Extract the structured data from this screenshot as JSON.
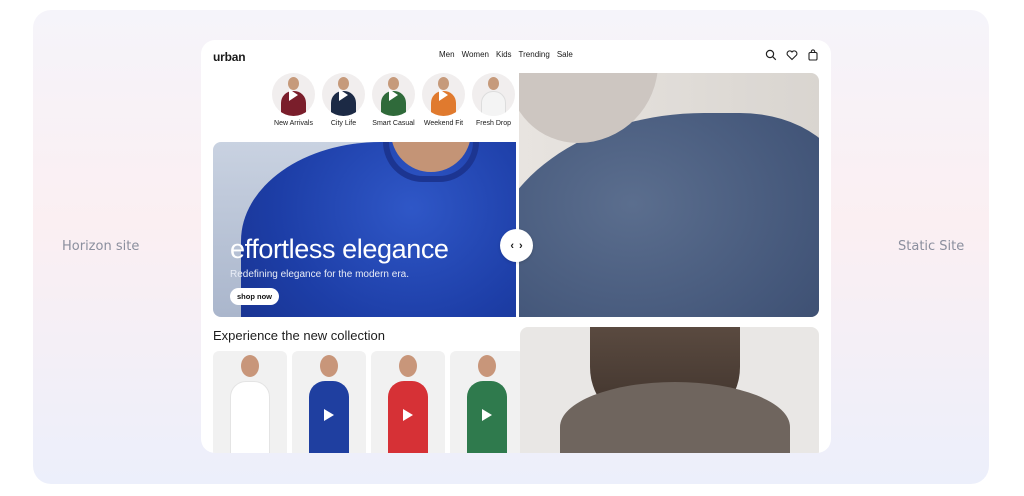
{
  "labels": {
    "left": "Horizon site",
    "right": "Static Site"
  },
  "header": {
    "logo": "urban",
    "nav": [
      "Men",
      "Women",
      "Kids",
      "Trending",
      "Sale"
    ],
    "icons": [
      "search-icon",
      "heart-icon",
      "bag-icon"
    ]
  },
  "stories": [
    {
      "label": "New Arrivals",
      "color": "#7a1e2b"
    },
    {
      "label": "City Life",
      "color": "#1c2a45"
    },
    {
      "label": "Smart Casual",
      "color": "#2f6a3a"
    },
    {
      "label": "Weekend Fit",
      "color": "#e07a2e"
    },
    {
      "label": "Fresh Drop",
      "color": "#f4f4f4"
    }
  ],
  "hero": {
    "title": "effortless elegance",
    "subtitle": "Redefining elegance for the modern era.",
    "cta": "shop now"
  },
  "slider": {
    "left": "‹",
    "right": "›"
  },
  "collection": {
    "title": "Experience the new collection",
    "cards": [
      {
        "color": "#ffffff"
      },
      {
        "color": "#1f3fa0"
      },
      {
        "color": "#d63136"
      },
      {
        "color": "#2f7a4d"
      }
    ]
  },
  "colors": {
    "accent": "#1d3ea7",
    "background": "#f5f4fa"
  }
}
